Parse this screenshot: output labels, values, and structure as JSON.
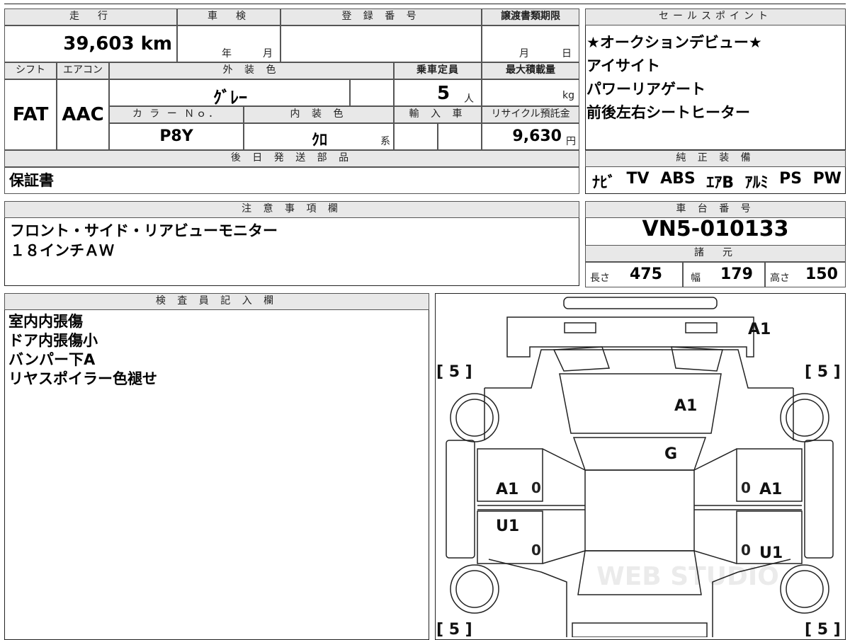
{
  "top_left": {
    "mileage": {
      "header": "走　行",
      "value": "39,603 km"
    },
    "shaken": {
      "header": "車　検",
      "year_unit": "年",
      "month_unit": "月"
    },
    "registration": {
      "header": "登 録 番 号",
      "value": ""
    },
    "transfer_deadline": {
      "header": "譲渡書類期限",
      "month_unit": "月",
      "day_unit": "日"
    },
    "shift": {
      "header": "シフト",
      "value": "FAT"
    },
    "aircon": {
      "header": "エアコン",
      "value": "AAC"
    },
    "exterior_color": {
      "header": "外 装 色",
      "value": "ｸﾞﾚｰ"
    },
    "capacity": {
      "header": "乗車定員",
      "value": "5",
      "unit": "人"
    },
    "max_load": {
      "header": "最大積載量",
      "unit": "kg"
    },
    "color_no": {
      "header": "カ ラ ー Ｎｏ．",
      "value": "P8Y"
    },
    "interior_color": {
      "header": "内 装 色",
      "value": "ｸﾛ",
      "suffix": "系"
    },
    "import": {
      "header": "輸 入 車"
    },
    "recycle": {
      "header": "リサイクル預託金",
      "value": "9,630",
      "unit": "円"
    },
    "later_parts": {
      "header": "後 日 発 送 部 品",
      "value": "保証書"
    }
  },
  "sales_points": {
    "header": "セールスポイント",
    "items": [
      "★オークションデビュー★",
      "アイサイト",
      "パワーリアゲート",
      "前後左右シートヒーター"
    ]
  },
  "genuine_equipment": {
    "header": "純 正 装 備",
    "items": [
      "ﾅﾋﾞ",
      "TV",
      "ABS",
      "ｴｱB",
      "ｱﾙﾐ",
      "PS",
      "PW"
    ]
  },
  "notes": {
    "header": "注 意 事 項 欄",
    "lines": [
      "フロント・サイド・リアビューモニター",
      "１８インチＡＷ"
    ]
  },
  "chassis": {
    "header": "車 台 番 号",
    "value": "VN5-010133"
  },
  "dimensions": {
    "header": "諸　元",
    "length": {
      "label": "長さ",
      "value": "475"
    },
    "width": {
      "label": "幅",
      "value": "179"
    },
    "height": {
      "label": "高さ",
      "value": "150"
    }
  },
  "inspector": {
    "header": "検 査 員 記 入 欄",
    "lines": [
      "室内内張傷",
      "ドア内張傷小",
      "バンパー下A",
      "リヤスポイラー色褪せ"
    ]
  },
  "diagram": {
    "tire_marks": [
      "[ 5 ]",
      "[ 5 ]",
      "[ 5 ]",
      "[ 5 ]"
    ],
    "labels": {
      "front_bumper": "A1",
      "hood": "A1",
      "windshield": "G",
      "left_front_door": "A1",
      "right_front_door": "A1",
      "left_rear_door": "U1",
      "right_rear_door": "U1",
      "zero": "0"
    },
    "watermark": "WEB STUDIO"
  },
  "colors": {
    "border": "#222222",
    "header_bg": "#e8e8e8"
  }
}
